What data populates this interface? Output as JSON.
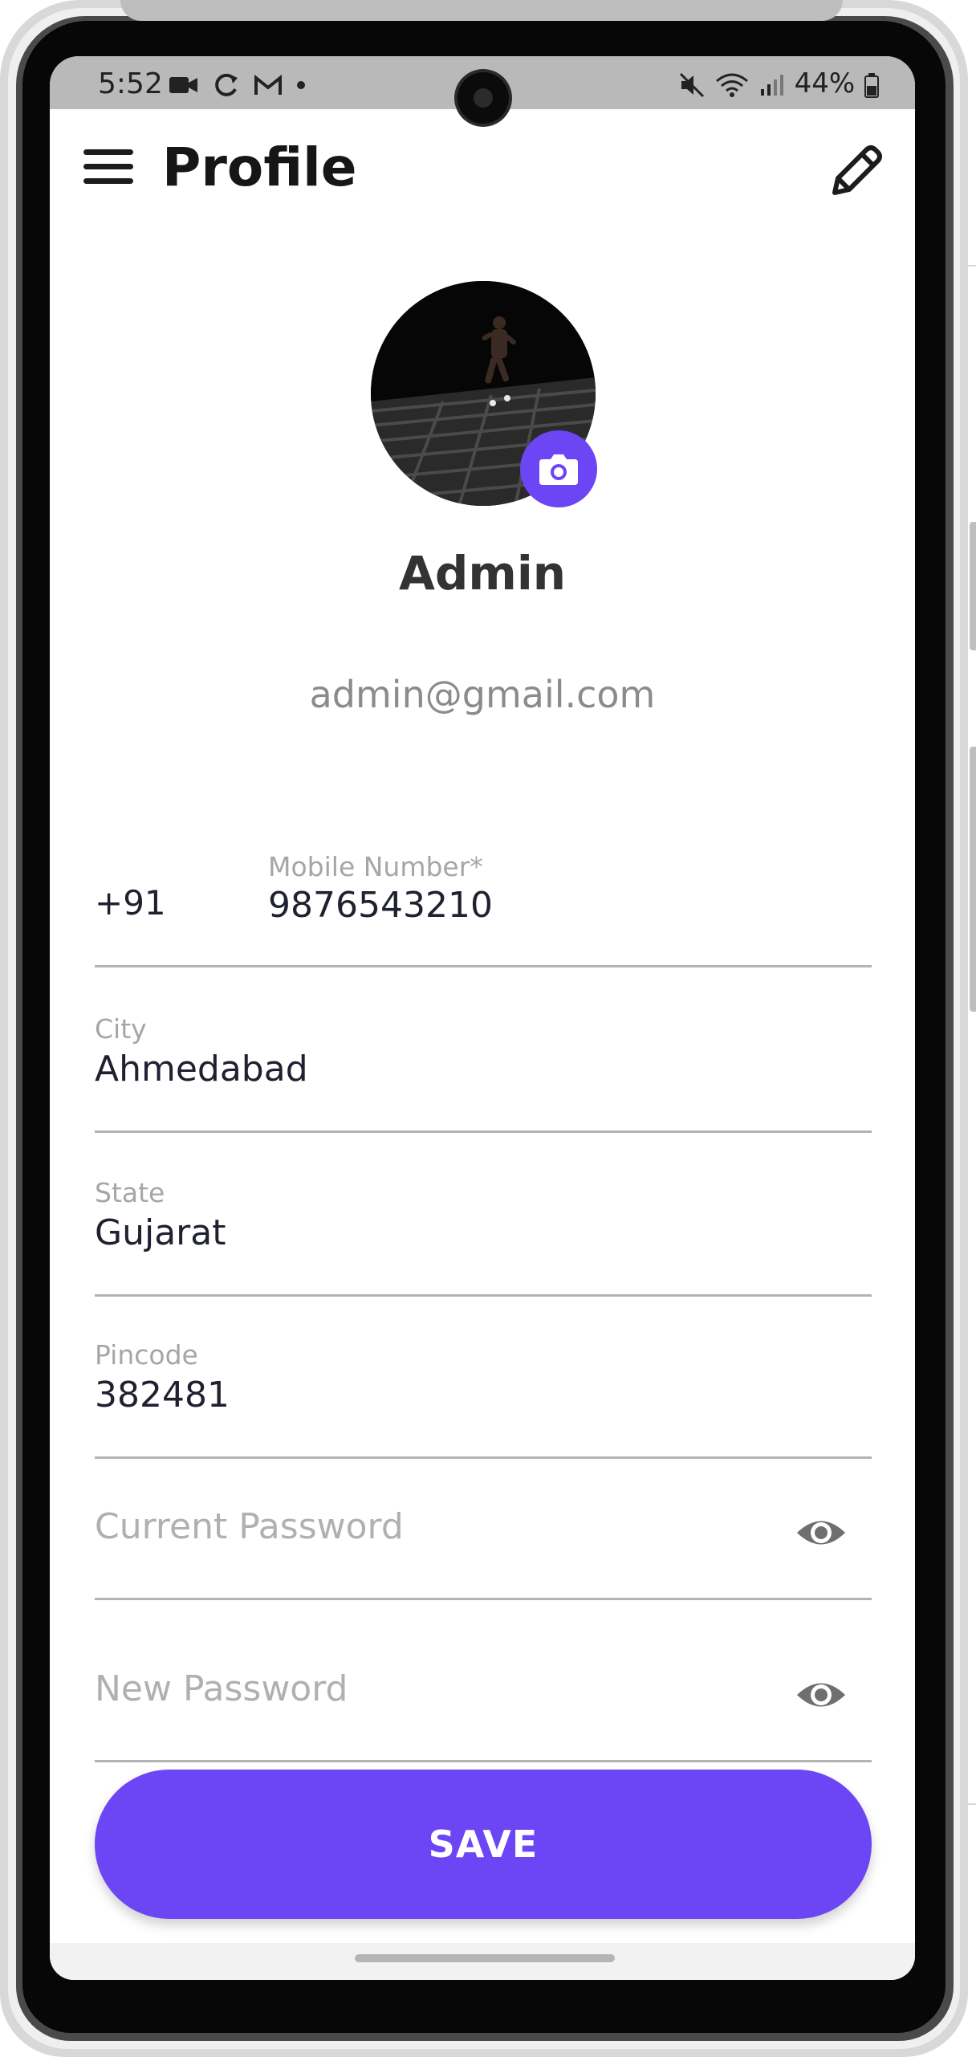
{
  "status_bar": {
    "time": "5:52",
    "left_icons": [
      "video-icon",
      "sync-icon",
      "gmail-icon",
      "dot-icon"
    ],
    "right_icons": [
      "mute-icon",
      "wifi-icon",
      "signal-icon",
      "battery-icon"
    ],
    "battery": "44%"
  },
  "appbar": {
    "title": "Profile",
    "menu_icon": "hamburger-menu-icon",
    "edit_icon": "pencil-icon"
  },
  "profile": {
    "name": "Admin",
    "email": "admin@gmail.com",
    "avatar_badge_icon": "camera-icon"
  },
  "form": {
    "mobile": {
      "country_code": "+91",
      "label": "Mobile Number*",
      "value": "9876543210"
    },
    "city": {
      "label": "City",
      "value": "Ahmedabad"
    },
    "state": {
      "label": "State",
      "value": "Gujarat"
    },
    "pincode": {
      "label": "Pincode",
      "value": "382481"
    },
    "current_password": {
      "placeholder": "Current Password",
      "icon": "eye-icon"
    },
    "new_password": {
      "placeholder": "New Password",
      "icon": "eye-icon"
    }
  },
  "actions": {
    "save_label": "SAVE"
  },
  "colors": {
    "accent": "#6c45f5",
    "status_bar": "#b9b9b9",
    "text": "#1f2030",
    "muted": "#a6a6a6"
  }
}
